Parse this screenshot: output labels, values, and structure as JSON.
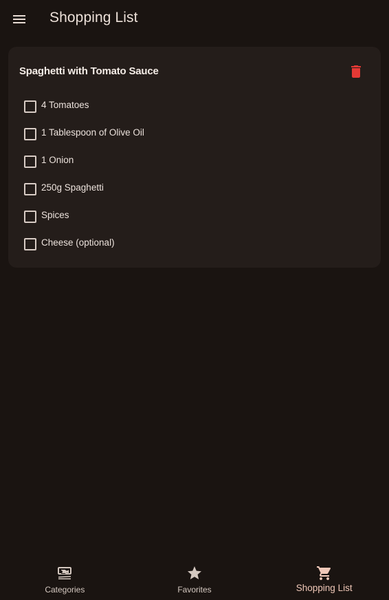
{
  "appbar": {
    "title": "Shopping List",
    "menu_icon": "menu-icon"
  },
  "card": {
    "title": "Spaghetti with Tomato Sauce",
    "delete_icon": "trash-icon",
    "delete_color": "#e53935",
    "items": [
      {
        "label": "4 Tomatoes",
        "checked": false
      },
      {
        "label": "1 Tablespoon of Olive Oil",
        "checked": false
      },
      {
        "label": "1 Onion",
        "checked": false
      },
      {
        "label": "250g Spaghetti",
        "checked": false
      },
      {
        "label": "Spices",
        "checked": false
      },
      {
        "label": "Cheese (optional)",
        "checked": false
      }
    ]
  },
  "bottom_nav": {
    "items": [
      {
        "label": "Categories",
        "icon": "set-meal-icon",
        "active": false
      },
      {
        "label": "Favorites",
        "icon": "star-icon",
        "active": false
      },
      {
        "label": "Shopping List",
        "icon": "shopping-cart-icon",
        "active": true
      }
    ],
    "active_color": "#f0c8b8"
  },
  "colors": {
    "background": "#1a1411",
    "card": "#241d1a"
  }
}
